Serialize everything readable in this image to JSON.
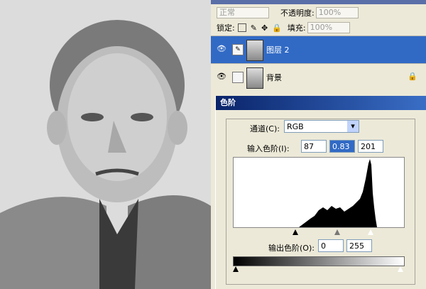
{
  "layers_panel": {
    "blend_mode": "正常",
    "opacity_label": "不透明度:",
    "opacity_value": "100%",
    "lock_label": "锁定:",
    "fill_label": "填充:",
    "fill_value": "100%",
    "layers": [
      {
        "name": "图层 2",
        "selected": true
      },
      {
        "name": "背景",
        "selected": false
      }
    ]
  },
  "levels_dialog": {
    "title": "色阶",
    "channel_label": "通道(C):",
    "channel_value": "RGB",
    "input_label": "输入色阶(I):",
    "input_black": "87",
    "input_gamma": "0.83",
    "input_white": "201",
    "output_label": "输出色阶(O):",
    "output_black": "0",
    "output_white": "255"
  },
  "colors": {
    "selection": "#316ac5",
    "title_start": "#0a246a",
    "title_end": "#3a6ec6"
  }
}
